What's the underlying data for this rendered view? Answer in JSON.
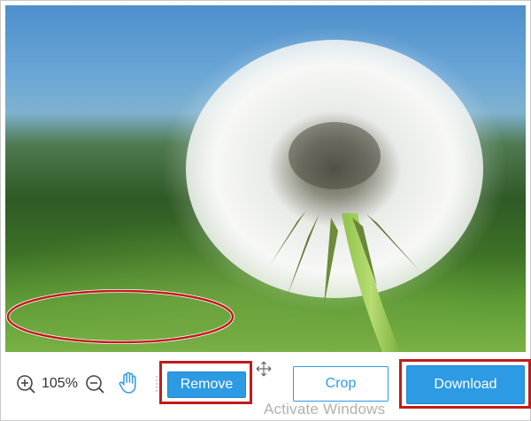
{
  "toolbar": {
    "zoom_in_icon": "zoom-in-icon",
    "zoom_level": "105%",
    "zoom_out_icon": "zoom-out-icon",
    "pan_icon": "hand-icon",
    "remove_label": "Remove",
    "move_icon": "move-icon",
    "crop_label": "Crop",
    "download_label": "Download"
  },
  "overlay": {
    "watermark": "Activate Windows"
  },
  "colors": {
    "accent": "#2d9ae4",
    "highlight": "#c21b1b"
  }
}
